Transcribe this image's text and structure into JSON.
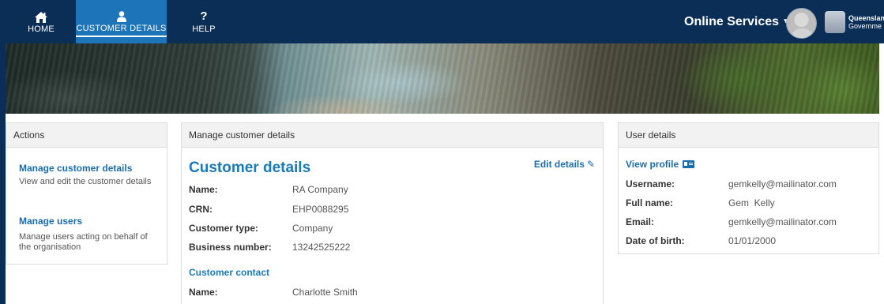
{
  "nav": {
    "home": {
      "label": "HOME",
      "icon": "home-icon"
    },
    "customer_details": {
      "label": "CUSTOMER DETAILS",
      "icon": "person-icon",
      "active": true
    },
    "help": {
      "label": "HELP",
      "icon": "question-icon",
      "glyph": "?"
    }
  },
  "header": {
    "online_services": "Online Services",
    "gov_logo": {
      "line1": "Queenslan",
      "line2": "Governme"
    }
  },
  "colors": {
    "nav_bg": "#0b2e57",
    "nav_active": "#1e74b9",
    "link": "#1a6cab",
    "heading": "#1a7ab8"
  },
  "actions": {
    "heading": "Actions",
    "items": [
      {
        "title": "Manage customer details",
        "description": "View and edit the customer details"
      },
      {
        "title": "Manage users",
        "description": "Manage users acting on behalf of the organisation"
      }
    ]
  },
  "manage": {
    "heading": "Manage customer details",
    "title": "Customer details",
    "edit_label": "Edit details",
    "fields": [
      {
        "label": "Name:",
        "value": "RA Company"
      },
      {
        "label": "CRN:",
        "value": "EHP0088295"
      },
      {
        "label": "Customer type:",
        "value": "Company"
      },
      {
        "label": "Business number:",
        "value": "13242525222"
      }
    ],
    "contact_heading": "Customer contact",
    "contact_fields": [
      {
        "label": "Name:",
        "value": "Charlotte Smith"
      }
    ]
  },
  "user": {
    "heading": "User details",
    "view_profile": "View profile",
    "fields": [
      {
        "label": "Username:",
        "value": "gemkelly@mailinator.com"
      },
      {
        "label": "Full name:",
        "value": "Gem  Kelly"
      },
      {
        "label": "Email:",
        "value": "gemkelly@mailinator.com"
      },
      {
        "label": "Date of birth:",
        "value": "01/01/2000"
      }
    ]
  }
}
